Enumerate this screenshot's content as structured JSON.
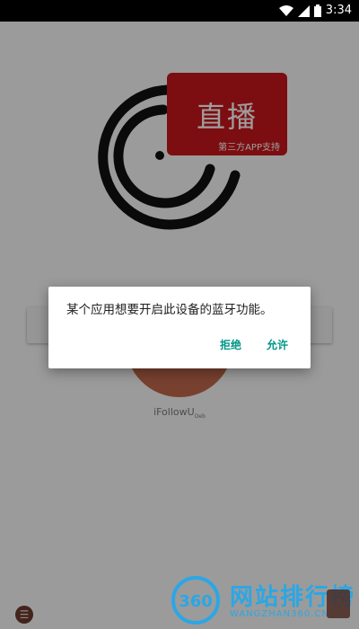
{
  "status_bar": {
    "time": "3:34",
    "icons": [
      "wifi-icon",
      "signal-icon",
      "battery-icon"
    ],
    "background": "#000000"
  },
  "app": {
    "live_badge_title": "直播",
    "live_badge_subtitle": "第三方APP支持",
    "brand_name": "iFollowU",
    "brand_suffix": "Oeb",
    "accent_red": "#c9161b"
  },
  "dialog": {
    "message": "某个应用想要开启此设备的蓝牙功能。",
    "deny_label": "拒绝",
    "allow_label": "允许",
    "button_color": "#009688"
  },
  "watermark": {
    "badge": "360",
    "text": "网站排行榜",
    "subtext": "WANGZHAN360.CN",
    "color": "#2aa7e6"
  }
}
